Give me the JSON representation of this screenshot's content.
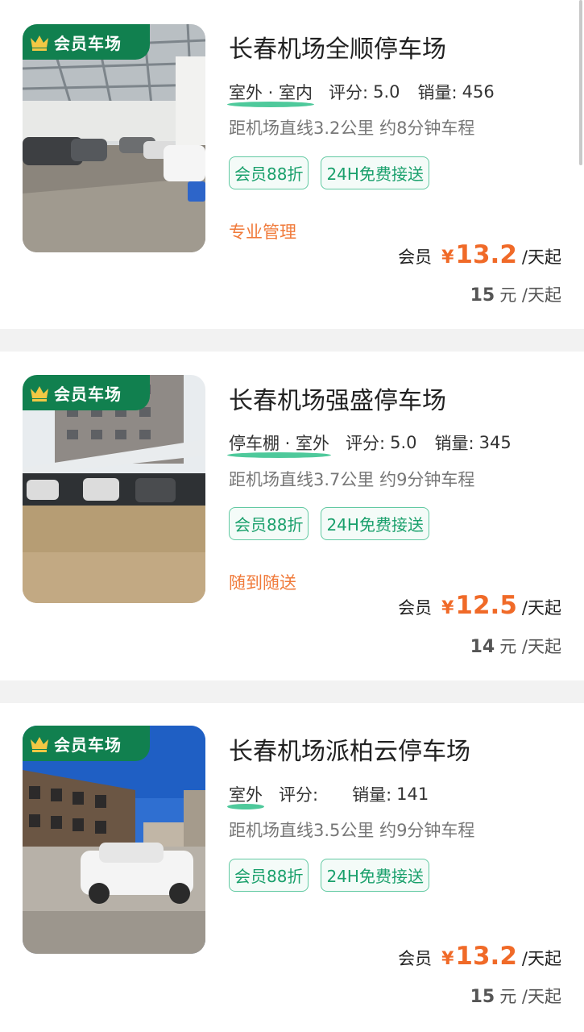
{
  "colors": {
    "accent_green": "#11804f",
    "price_orange": "#f06a28",
    "feature_orange": "#f07a3a",
    "pill_green": "#1aa06c"
  },
  "lots": [
    {
      "badge": "会员车场",
      "name": "长春机场全顺停车场",
      "type": "室外 · 室内",
      "rating_label": "评分:",
      "rating": "5.0",
      "sales_label": "销量:",
      "sales": "456",
      "distance": "距机场直线3.2公里 约8分钟车程",
      "tags": [
        "会员88折",
        "24H免费接送"
      ],
      "feature": "专业管理",
      "member_label": "会员",
      "currency": "¥",
      "member_price": "13.2",
      "price_unit": "/天起",
      "original_price": "15",
      "original_unit": "元 /天起",
      "image_icon": "warehouse-parking-photo"
    },
    {
      "badge": "会员车场",
      "name": "长春机场强盛停车场",
      "type": "停车棚 · 室外",
      "rating_label": "评分:",
      "rating": "5.0",
      "sales_label": "销量:",
      "sales": "345",
      "distance": "距机场直线3.7公里 约9分钟车程",
      "tags": [
        "会员88折",
        "24H免费接送"
      ],
      "feature": "随到随送",
      "member_label": "会员",
      "currency": "¥",
      "member_price": "12.5",
      "price_unit": "/天起",
      "original_price": "14",
      "original_unit": "元 /天起",
      "image_icon": "carport-parking-photo"
    },
    {
      "badge": "会员车场",
      "name": "长春机场派柏云停车场",
      "type": "室外",
      "rating_label": "评分:",
      "rating": "",
      "sales_label": "销量:",
      "sales": "141",
      "distance": "距机场直线3.5公里 约9分钟车程",
      "tags": [
        "会员88折",
        "24H免费接送"
      ],
      "feature": "",
      "member_label": "会员",
      "currency": "¥",
      "member_price": "13.2",
      "price_unit": "/天起",
      "original_price": "15",
      "original_unit": "元 /天起",
      "image_icon": "outdoor-lot-photo"
    }
  ]
}
